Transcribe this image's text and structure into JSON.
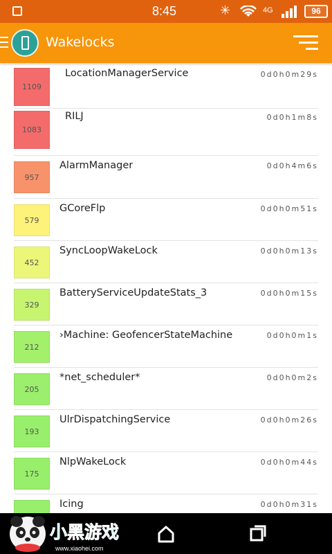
{
  "status_bar": {
    "time": "8:45",
    "network": "4G",
    "battery": "96",
    "colors": {
      "background": "#e0620f"
    }
  },
  "app_bar": {
    "title": "Wakelocks",
    "colors": {
      "background": "#f7950b",
      "logo": "#2ca197"
    },
    "icons": [
      "menu-icon",
      "app-logo-icon",
      "sort-icon"
    ]
  },
  "wakelocks": [
    {
      "count": "1109",
      "name": "LocationManagerService",
      "duration": "0d0h0m29s",
      "color": "#f46b6b"
    },
    {
      "count": "1083",
      "name": "RILJ",
      "duration": "0d0h1m8s",
      "color": "#f46b6b"
    },
    {
      "count": "957",
      "name": "AlarmManager",
      "duration": "0d0h4m6s",
      "color": "#f8926a"
    },
    {
      "count": "579",
      "name": "GCoreFlp",
      "duration": "0d0h0m51s",
      "color": "#fdf27a"
    },
    {
      "count": "452",
      "name": "SyncLoopWakeLock",
      "duration": "0d0h0m13s",
      "color": "#ecf779"
    },
    {
      "count": "329",
      "name": "BatteryServiceUpdateStats_3",
      "duration": "0d0h0m15s",
      "color": "#c7f56f"
    },
    {
      "count": "212",
      "name": "›Machine: GeofencerStateMachine",
      "duration": "0d0h0m1s",
      "color": "#a3f06b"
    },
    {
      "count": "205",
      "name": "*net_scheduler*",
      "duration": "0d0h0m2s",
      "color": "#9bef6c"
    },
    {
      "count": "193",
      "name": "UlrDispatchingService",
      "duration": "0d0h0m26s",
      "color": "#98ef6b"
    },
    {
      "count": "175",
      "name": "NlpWakeLock",
      "duration": "0d0h0m44s",
      "color": "#98ef6b"
    },
    {
      "count": "",
      "name": "Icing",
      "duration": "0d0h0m31s",
      "color": "#98ef6b"
    }
  ],
  "nav_bar": {
    "watermark": "小黑游戏",
    "watermark_url": "www.xiaohei.com",
    "icons": [
      "home-icon",
      "recent-apps-icon"
    ]
  }
}
